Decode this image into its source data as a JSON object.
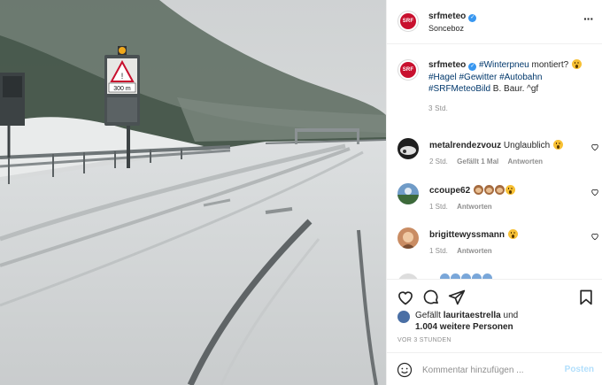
{
  "post": {
    "username": "srfmeteo",
    "verified": true,
    "location": "Sonceboz",
    "avatar_text": "SRF",
    "brand_color": "#c8102e"
  },
  "caption": {
    "username": "srfmeteo",
    "text_plain": "",
    "tag_winterpneu": "#Winterpneu",
    "text_after": " montiert?",
    "tags_line1": [
      "#Hagel",
      "#Gewitter",
      "#Autobahn"
    ],
    "tags_line2_tag": "#SRFMeteoBild",
    "tags_line2_text": " B. Baur. ^gf",
    "time": "3 Std."
  },
  "comments": [
    {
      "username": "metalrendezvouz",
      "text": "Unglaublich",
      "time": "2 Std.",
      "likes": "Gefällt 1 Mal",
      "reply": "Antworten"
    },
    {
      "username": "ccoupe62",
      "text": "",
      "time": "1 Std.",
      "likes": "",
      "reply": "Antworten"
    },
    {
      "username": "brigittewyssmann",
      "text": "",
      "time": "1 Std.",
      "likes": "",
      "reply": "Antworten"
    },
    {
      "username": "...",
      "text": "",
      "time": "",
      "likes": "",
      "reply": ""
    }
  ],
  "likes": {
    "prefix": "Gefällt",
    "user": "lauritaestrella",
    "connector": "und",
    "others": "1.004 weitere Personen"
  },
  "posted": "VOR 3 STUNDEN",
  "compose": {
    "placeholder": "Kommentar hinzufügen ...",
    "post_label": "Posten"
  },
  "photo_sign": {
    "distance": "300 m"
  }
}
